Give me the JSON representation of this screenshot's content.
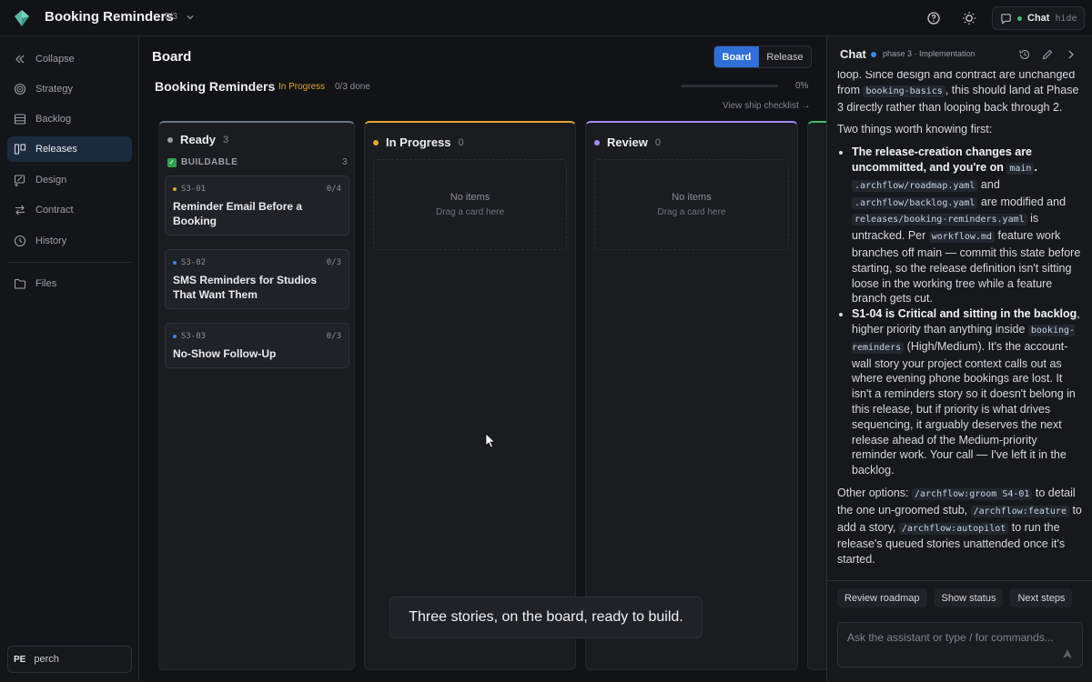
{
  "topbar": {
    "title": "Booking Reminders",
    "count": "0/3",
    "chat_label": "Chat",
    "hide_label": "hide"
  },
  "sidebar": {
    "items": [
      {
        "label": "Collapse",
        "icon": "collapse-icon"
      },
      {
        "label": "Strategy",
        "icon": "target-icon"
      },
      {
        "label": "Backlog",
        "icon": "list-icon"
      },
      {
        "label": "Releases",
        "icon": "board-icon",
        "active": true
      },
      {
        "label": "Design",
        "icon": "design-icon"
      },
      {
        "label": "Contract",
        "icon": "contract-icon"
      },
      {
        "label": "History",
        "icon": "clock-icon"
      },
      {
        "label": "Files",
        "icon": "folder-icon"
      }
    ],
    "user": {
      "initials": "PE",
      "name": "perch"
    }
  },
  "main": {
    "title": "Board",
    "view_toggle": {
      "board": "Board",
      "release": "Release"
    },
    "release": {
      "name": "Booking Reminders",
      "status": "In Progress",
      "done": "0/3 done",
      "progress": 0,
      "progress_label": "0%",
      "ship_link": "View ship checklist →"
    },
    "columns": [
      {
        "name": "Ready",
        "count": "3",
        "accent": "#6b7280",
        "group": {
          "label": "BUILDABLE",
          "count": "3"
        },
        "cards": [
          {
            "id": "S3-01",
            "progress": "0/4",
            "title": "Reminder Email Before a Booking",
            "dot": "#e2a631"
          },
          {
            "id": "S3-02",
            "progress": "0/3",
            "title": "SMS Reminders for Studios That Want Them",
            "dot": "#3b82f6"
          },
          {
            "id": "S3-03",
            "progress": "0/3",
            "title": "No-Show Follow-Up",
            "dot": "#3b82f6"
          }
        ]
      },
      {
        "name": "In Progress",
        "count": "0",
        "accent": "#e2a631",
        "empty": "No items",
        "empty_hint": "Drag a card here"
      },
      {
        "name": "Review",
        "count": "0",
        "accent": "#a78bfa",
        "empty": "No items",
        "empty_hint": "Drag a card here"
      }
    ],
    "toast": "Three stories, on the board, ready to build."
  },
  "chat": {
    "title": "Chat",
    "phase": "phase 3 · Implementation",
    "messages": {
      "p1_a": "loop. Since design and contract are unchanged from ",
      "p1_code": "booking-basics",
      "p1_b": ", this should land at Phase 3 directly rather than looping back through 2.",
      "p2": "Two things worth knowing first:",
      "b1_bold": "The release-creation changes are uncommitted, and you're on ",
      "b1_code_main": "main",
      "b1_dot": ".",
      "b1_code1": ".archflow/roadmap.yaml",
      "b1_and": " and ",
      "b1_code2": ".archflow/backlog.yaml",
      "b1_mod": " are modified and ",
      "b1_code3": "releases/booking-reminders.yaml",
      "b1_untracked": " is untracked. Per ",
      "b1_code4": "workflow.md",
      "b1_rest": " feature work branches off main — commit this state before starting, so the release definition isn't sitting loose in the working tree while a feature branch gets cut.",
      "b2_bold": "S1-04 is Critical and sitting in the backlog",
      "b2_a": ", higher priority than anything inside ",
      "b2_code": "booking-reminders",
      "b2_rest": " (High/Medium). It's the account-wall story your project context calls out as where evening phone bookings are lost. It isn't a reminders story so it doesn't belong in this release, but if priority is what drives sequencing, it arguably deserves the next release ahead of the Medium-priority reminder work. Your call — I've left it in the backlog.",
      "p3_a": "Other options: ",
      "p3_code1": "/archflow:groom S4-01",
      "p3_b": " to detail the one un-groomed stub, ",
      "p3_code2": "/archflow:feature",
      "p3_c": " to add a story, ",
      "p3_code3": "/archflow:autopilot",
      "p3_d": " to run the release's queued stories unattended once it's started."
    },
    "suggestions": [
      "Review roadmap",
      "Show status",
      "Next steps"
    ],
    "input_placeholder": "Ask the assistant or type / for commands..."
  }
}
